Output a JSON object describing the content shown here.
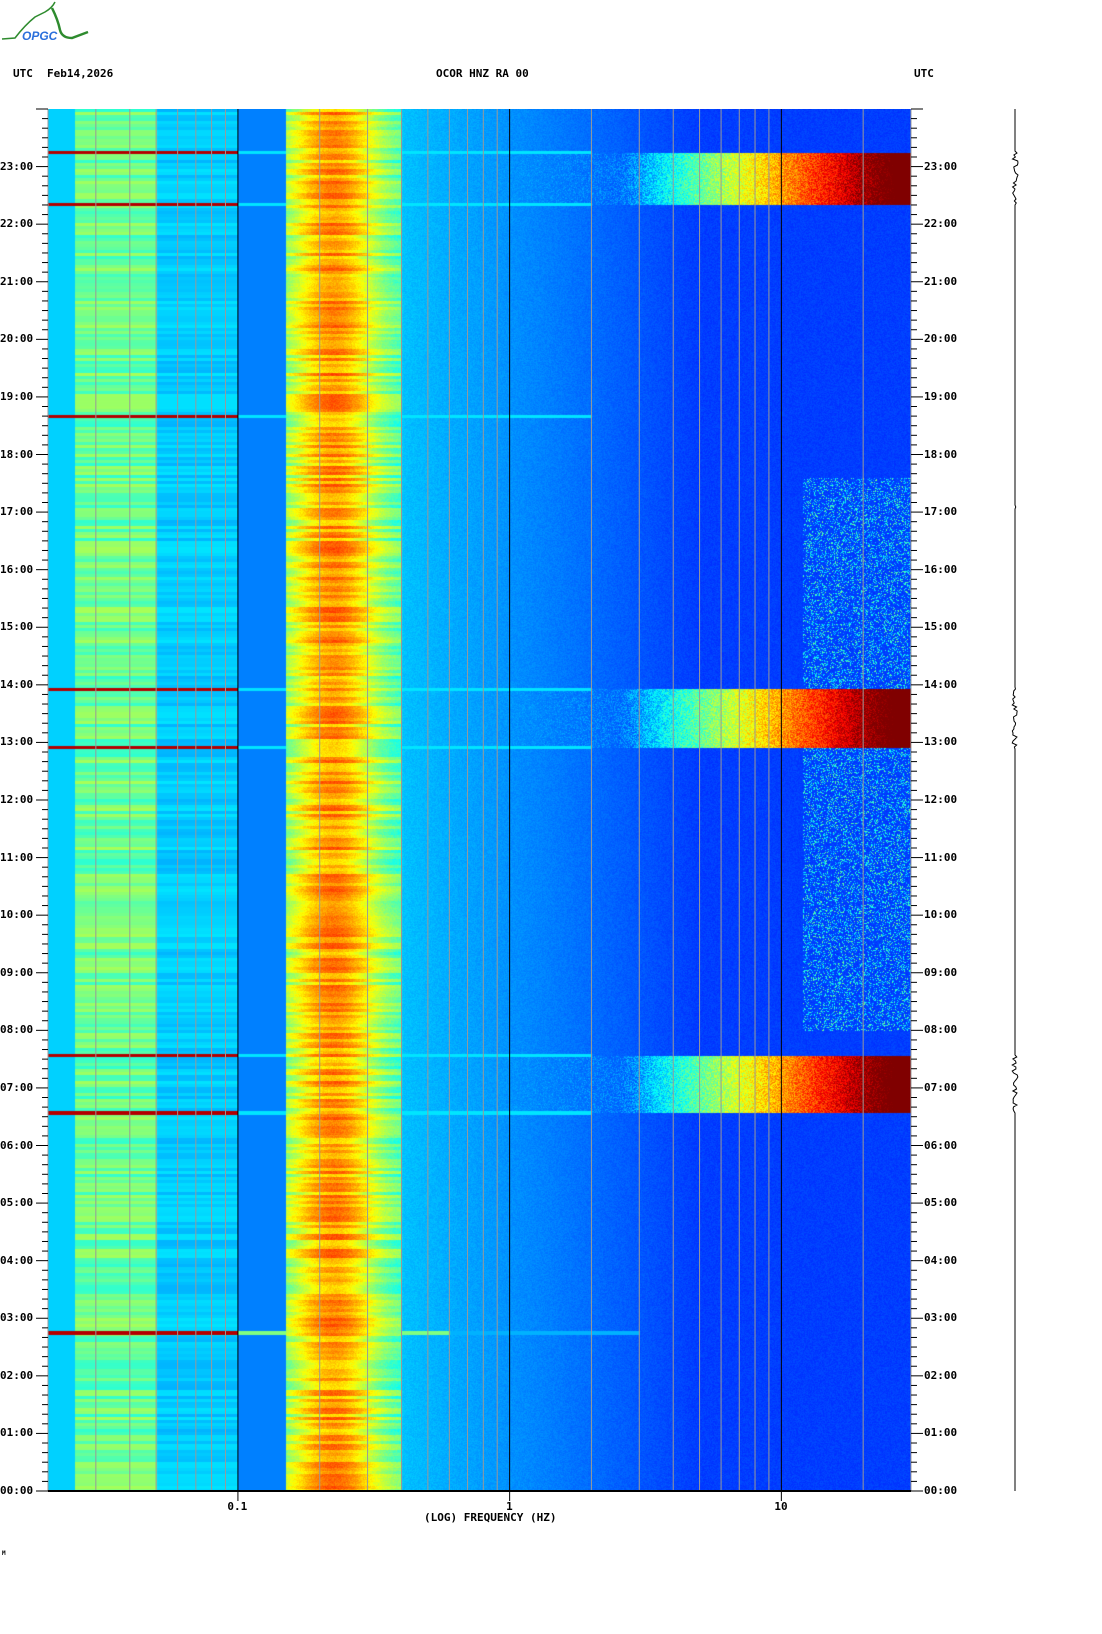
{
  "logo": {
    "text": "OPGC",
    "colors": {
      "arc": "#2e8b2e",
      "text": "#2a6fdb"
    }
  },
  "header": {
    "left_tz": "UTC",
    "date": "Feb14,2026",
    "station": "OCOR HNZ RA 00",
    "right_tz": "UTC"
  },
  "footer_mark": "M",
  "chart_data": {
    "type": "heatmap",
    "title": "OCOR HNZ RA 00",
    "xlabel": "(LOG) FREQUENCY (HZ)",
    "ylabel": "UTC",
    "xscale": "log",
    "xlim": [
      0.02,
      30
    ],
    "ylim": [
      0,
      24
    ],
    "x_tick_labels": [
      {
        "value": 0.1,
        "label": "0.1"
      },
      {
        "value": 1,
        "label": "1"
      },
      {
        "value": 10,
        "label": "10"
      }
    ],
    "y_tick_labels": [
      "00:00",
      "01:00",
      "02:00",
      "03:00",
      "04:00",
      "05:00",
      "06:00",
      "07:00",
      "08:00",
      "09:00",
      "10:00",
      "11:00",
      "12:00",
      "13:00",
      "14:00",
      "15:00",
      "16:00",
      "17:00",
      "18:00",
      "19:00",
      "20:00",
      "21:00",
      "22:00",
      "23:00"
    ],
    "colormap": "jet",
    "microseism_band_hz": [
      0.15,
      0.35
    ],
    "high_frequency_bursts": [
      {
        "start_h": 22.35,
        "end_h": 23.25,
        "min_freq_hz": 3
      },
      {
        "start_h": 12.92,
        "end_h": 13.93,
        "min_freq_hz": 3
      },
      {
        "start_h": 6.57,
        "end_h": 7.57,
        "min_freq_hz": 3
      }
    ],
    "broadband_lines_h": [
      23.25,
      22.35,
      18.67,
      13.93,
      12.92,
      7.57,
      6.57,
      2.75
    ],
    "hf_noise_window_h": [
      8.0,
      17.6
    ]
  }
}
